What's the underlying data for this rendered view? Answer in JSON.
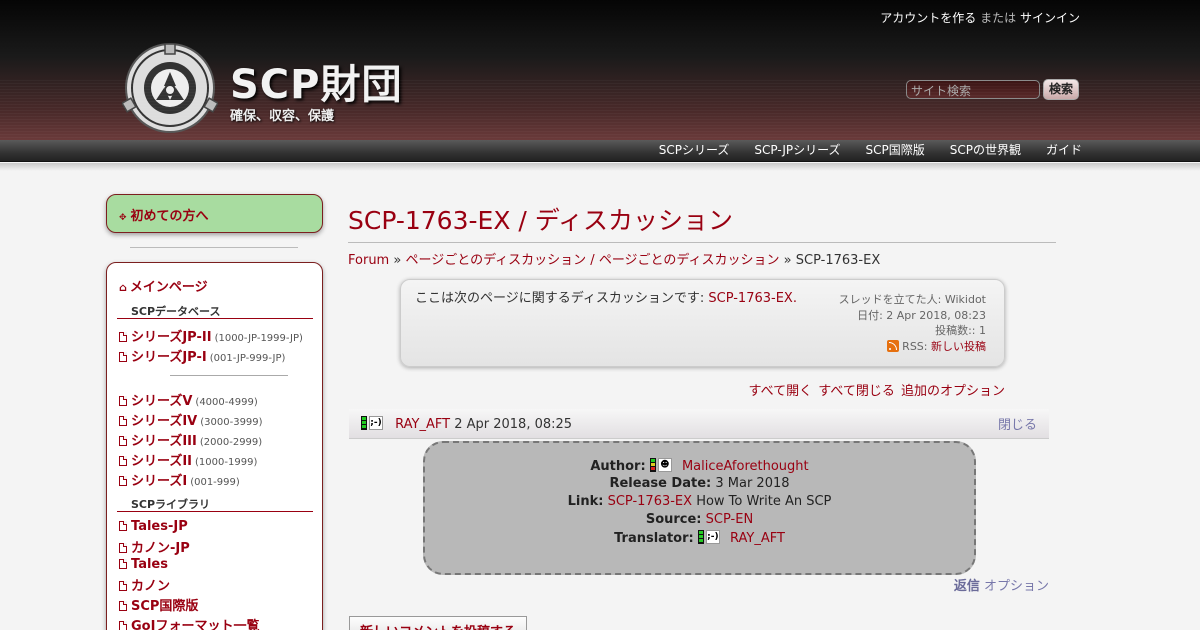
{
  "header": {
    "account": {
      "create_label": "アカウントを作る",
      "or_label": "または",
      "signin_label": "サインイン"
    },
    "site_title": "SCP財団",
    "site_subtitle": "確保、収容、保護",
    "search": {
      "placeholder": "サイト検索",
      "button_label": "検索"
    }
  },
  "topnav": {
    "items": [
      {
        "label": "SCPシリーズ"
      },
      {
        "label": "SCP-JPシリーズ"
      },
      {
        "label": "SCP国際版"
      },
      {
        "label": "SCPの世界観"
      },
      {
        "label": "ガイド"
      }
    ]
  },
  "sidebar": {
    "first_time": "初めての方へ",
    "main_page": "メインページ",
    "database_heading": "SCPデータベース",
    "jp_series": [
      {
        "label": "シリーズJP-II",
        "range": "(1000-JP-1999-JP)"
      },
      {
        "label": "シリーズJP-I",
        "range": "(001-JP-999-JP)"
      }
    ],
    "series": [
      {
        "label": "シリーズV",
        "range": "(4000-4999)"
      },
      {
        "label": "シリーズIV",
        "range": "(3000-3999)"
      },
      {
        "label": "シリーズIII",
        "range": "(2000-2999)"
      },
      {
        "label": "シリーズII",
        "range": "(1000-1999)"
      },
      {
        "label": "シリーズI",
        "range": "(001-999)"
      }
    ],
    "library_heading": "SCPライブラリ",
    "library": [
      {
        "label": "Tales-JP"
      },
      {
        "label": "カノン-JP"
      },
      {
        "label": "Tales"
      },
      {
        "label": "カノン"
      },
      {
        "label": "SCP国際版"
      },
      {
        "label": "GoIフォーマット一覧"
      }
    ]
  },
  "main": {
    "title": "SCP-1763-EX / ディスカッション",
    "breadcrumb": {
      "forum": "Forum",
      "sep": "»",
      "category": "ページごとのディスカッション / ページごとのディスカッション",
      "current": "SCP-1763-EX"
    },
    "thread": {
      "desc_prefix": "ここは次のページに関するディスカッションです:",
      "desc_link": "SCP-1763-EX.",
      "started_by": "スレッドを立てた人: Wikidot",
      "date": "日付: 2 Apr 2018, 08:23",
      "posts": "投稿数:: 1",
      "rss_label": "RSS:",
      "rss_link": "新しい投稿"
    },
    "options": {
      "expand_all": "すべて開く",
      "collapse_all": "すべて閉じる",
      "more_options": "追加のオプション"
    },
    "post": {
      "author": "RAY_AFT",
      "date": "2 Apr 2018, 08:25",
      "close_label": "閉じる",
      "body": {
        "author_label": "Author:",
        "author_value": "MaliceAforethought",
        "release_label": "Release Date:",
        "release_value": "3 Mar 2018",
        "link_label": "Link:",
        "link_value": "SCP-1763-EX",
        "link_suffix": "How To Write An SCP",
        "source_label": "Source:",
        "source_value": "SCP-EN",
        "translator_label": "Translator:",
        "translator_value": "RAY_AFT"
      },
      "reply_label": "返信",
      "options_label": "オプション"
    },
    "new_comment_label": "新しいコメントを投稿する"
  },
  "colors": {
    "accent": "#990011",
    "sidebar_green": "#a8dca0",
    "post_body": "#b8b8b8"
  }
}
